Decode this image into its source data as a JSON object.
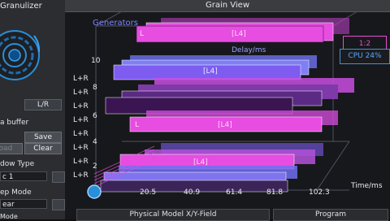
{
  "left_panel": {
    "title": "Granulizer",
    "lr_button": "L/R",
    "buffer_label": "a buffer",
    "save_label": "Save",
    "load_label": "oad",
    "clear_label": "Clear",
    "window_type_label": "dow Type",
    "window_type_value": "c 1",
    "sweep_mode_label": "ep Mode",
    "sweep_mode_value": "ear",
    "mode_label": "Mode"
  },
  "grain_view": {
    "title": "Grain View",
    "generators_label": "Generators",
    "delay_axis_label": "Delay/ms",
    "time_axis_label": "Time/ms",
    "cpu_label": "CPU 24%",
    "grain_readout": "1:2",
    "y_ticks": [
      "10",
      "8",
      "6",
      "4",
      "2"
    ],
    "side_labels": [
      "L+R",
      "L+R",
      "L+R",
      "L+R",
      "L+R",
      "L+R",
      "L+R",
      "L+R"
    ],
    "x_ticks": [
      "20.5",
      "40.9",
      "61.4",
      "81.8",
      "102.3"
    ],
    "grain_labels": [
      "L",
      "[L4]",
      "[L4]",
      "L",
      "[L4]",
      "[L4]"
    ],
    "colors": {
      "magenta": "#e64de0",
      "purple": "#7f5cf0",
      "blue": "#6f73ef",
      "dark_purple": "#4a1f66",
      "grid": "#4f5262"
    }
  },
  "bottom_tabs": {
    "physical_model": "Physical Model X/Y-Field",
    "program": "Program"
  }
}
